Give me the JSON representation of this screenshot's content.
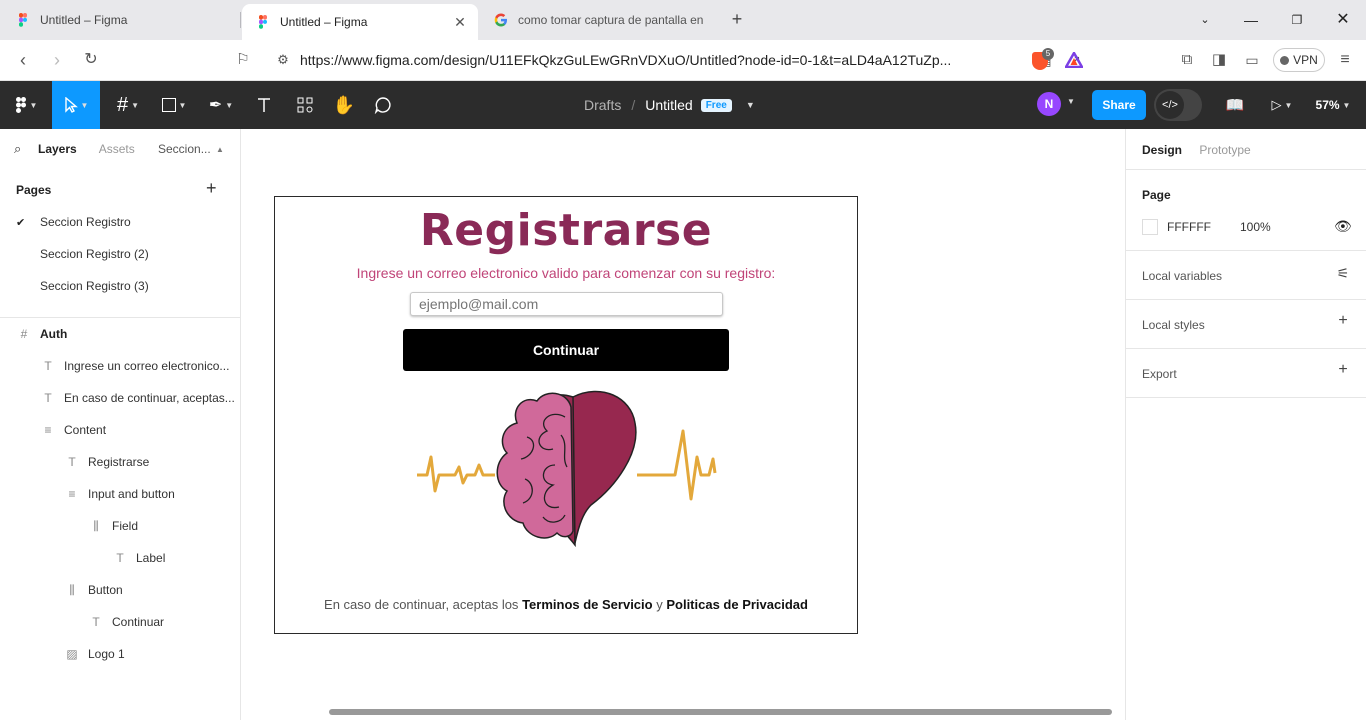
{
  "browser": {
    "tabs": [
      {
        "title": "Untitled – Figma",
        "active": false,
        "icon": "figma-icon"
      },
      {
        "title": "Untitled – Figma",
        "active": true,
        "icon": "figma-icon"
      },
      {
        "title": "como tomar captura de pantalla en",
        "active": false,
        "icon": "google-icon"
      }
    ],
    "url": "https://www.figma.com/design/U11EFkQkzGuLEwGRnVDXuO/Untitled?node-id=0-1&t=aLD4aA12TuZp...",
    "brave_badge": "5",
    "vpn_label": "VPN"
  },
  "toolbar": {
    "breadcrumb_root": "Drafts",
    "file_name": "Untitled",
    "plan_badge": "Free",
    "avatar_initial": "N",
    "share_label": "Share",
    "zoom": "57%"
  },
  "left_panel": {
    "tabs": [
      "Layers",
      "Assets"
    ],
    "page_selector": "Seccion...",
    "pages_title": "Pages",
    "pages": [
      {
        "label": "Seccion Registro",
        "current": true
      },
      {
        "label": "Seccion Registro (2)",
        "current": false
      },
      {
        "label": "Seccion Registro (3)",
        "current": false
      }
    ],
    "layers": [
      {
        "label": "Auth",
        "icon": "frame-icon",
        "depth": 0
      },
      {
        "label": "Ingrese un correo electronico...",
        "icon": "text-icon",
        "depth": 1
      },
      {
        "label": "En caso de continuar, aceptas...",
        "icon": "text-icon",
        "depth": 1
      },
      {
        "label": "Content",
        "icon": "auto-layout-vertical-icon",
        "depth": 1
      },
      {
        "label": "Registrarse",
        "icon": "text-icon",
        "depth": 2
      },
      {
        "label": "Input and button",
        "icon": "auto-layout-vertical-icon",
        "depth": 2
      },
      {
        "label": "Field",
        "icon": "auto-layout-horizontal-icon",
        "depth": 3
      },
      {
        "label": "Label",
        "icon": "text-icon",
        "depth": 4
      },
      {
        "label": "Button",
        "icon": "auto-layout-horizontal-icon",
        "depth": 2
      },
      {
        "label": "Continuar",
        "icon": "text-icon",
        "depth": 3
      },
      {
        "label": "Logo 1",
        "icon": "image-icon",
        "depth": 2
      }
    ]
  },
  "canvas": {
    "heading": "Registrarse",
    "subtitle": "Ingrese un correo electronico valido para comenzar con su registro:",
    "email_placeholder": "ejemplo@mail.com",
    "button_label": "Continuar",
    "terms_prefix": "En caso de continuar, aceptas los",
    "terms_link1": "Terminos de Servicio",
    "terms_and": "y",
    "terms_link2": "Politicas de Privacidad",
    "colors": {
      "heading": "#8a2a57",
      "subtitle": "#c04478",
      "heart": "#97284f",
      "brain": "#d0699a",
      "pulse": "#e3a83b"
    }
  },
  "right_panel": {
    "tabs": [
      "Design",
      "Prototype"
    ],
    "page_title": "Page",
    "page_fill_hex": "FFFFFF",
    "page_fill_opacity": "100%",
    "sections": [
      "Local variables",
      "Local styles",
      "Export"
    ]
  }
}
